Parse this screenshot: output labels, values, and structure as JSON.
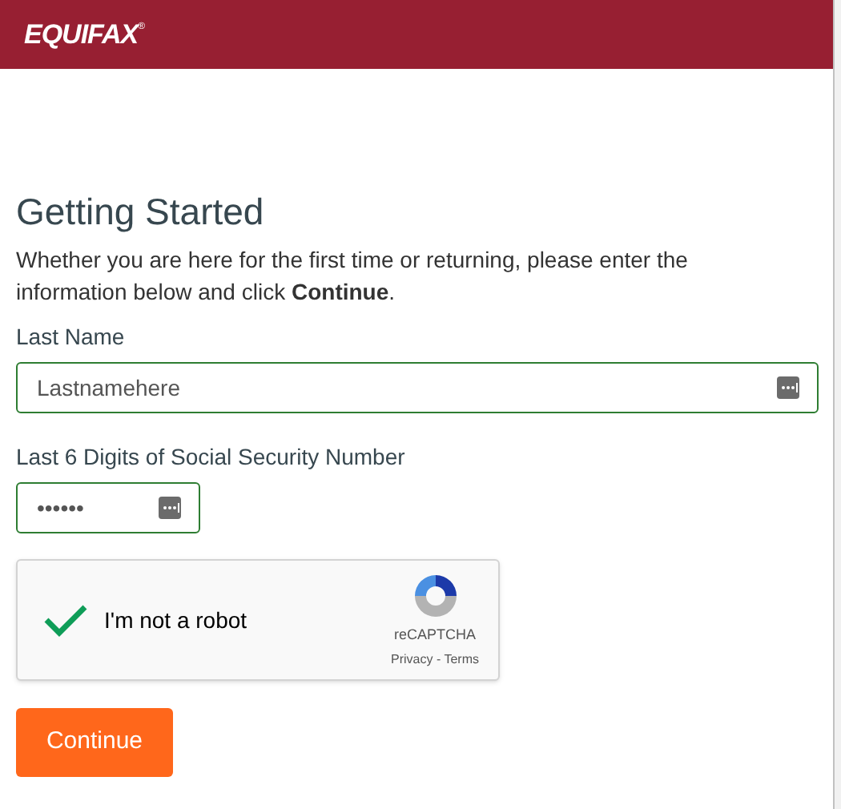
{
  "header": {
    "logo": "EQUIFAX",
    "logo_mark": "®"
  },
  "heading": "Getting Started",
  "intro": "Whether you are here for the first time or returning, please enter the information below and click **Continue**.",
  "fields": [
    {
      "label": "Last Name",
      "value": "Lastnamehere",
      "kind": "wide"
    },
    {
      "label": "Last 6 Digits of Social Security Number",
      "value": "••••••",
      "kind": "narrow"
    }
  ],
  "captcha": {
    "label": "I'm not a robot",
    "checked": true,
    "brand": "reCAPTCHA",
    "links": "Privacy - Terms"
  },
  "button": "Continue"
}
